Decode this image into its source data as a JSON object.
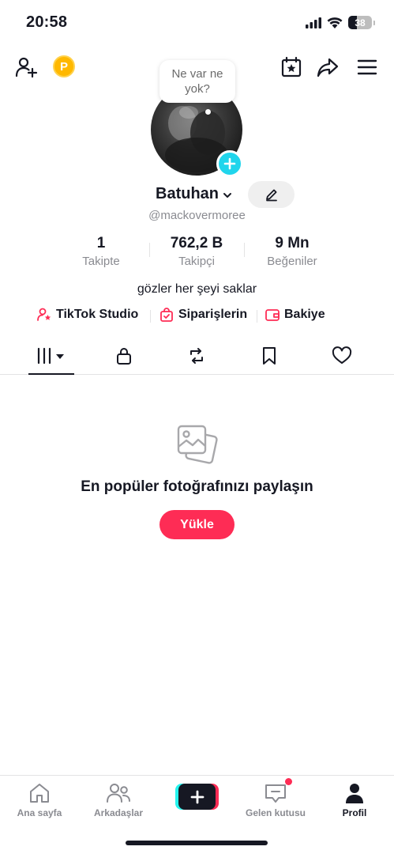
{
  "status_bar": {
    "time": "20:58",
    "battery": "38",
    "battery_level": 0.38,
    "icons": [
      "signal-icon",
      "wifi-icon",
      "battery-icon"
    ]
  },
  "top_nav": {
    "icons": [
      "add-friend-icon",
      "coin-icon",
      "calendar-star-icon",
      "share-icon",
      "menu-icon"
    ],
    "coin_letter": "P"
  },
  "profile": {
    "bubble_text": "Ne var ne yok?",
    "username": "Batuhan",
    "handle": "@mackovermoree",
    "bio": "gözler her şeyi saklar"
  },
  "stats": [
    {
      "value": "1",
      "label": "Takipte"
    },
    {
      "value": "762,2 B",
      "label": "Takipçi"
    },
    {
      "value": "9 Mn",
      "label": "Beğeniler"
    }
  ],
  "links": [
    {
      "label": "TikTok Studio",
      "icon": "studio-icon"
    },
    {
      "label": "Siparişlerin",
      "icon": "shopping-bag-icon"
    },
    {
      "label": "Bakiye",
      "icon": "wallet-icon"
    }
  ],
  "tabs": [
    "videos-grid",
    "private-lock",
    "reposts",
    "favorites",
    "liked"
  ],
  "empty_state": {
    "title": "En popüler fotoğrafınızı paylaşın",
    "button": "Yükle"
  },
  "bottom_nav": {
    "home": "Ana sayfa",
    "friends": "Arkadaşlar",
    "inbox": "Gelen kutusu",
    "profile": "Profil"
  },
  "colors": {
    "accent": "#fe2c55",
    "cyan": "#25f4ee",
    "badge": "#20d5ec",
    "coin": "#ffb800",
    "text": "#161823",
    "muted": "#8a8b91"
  }
}
